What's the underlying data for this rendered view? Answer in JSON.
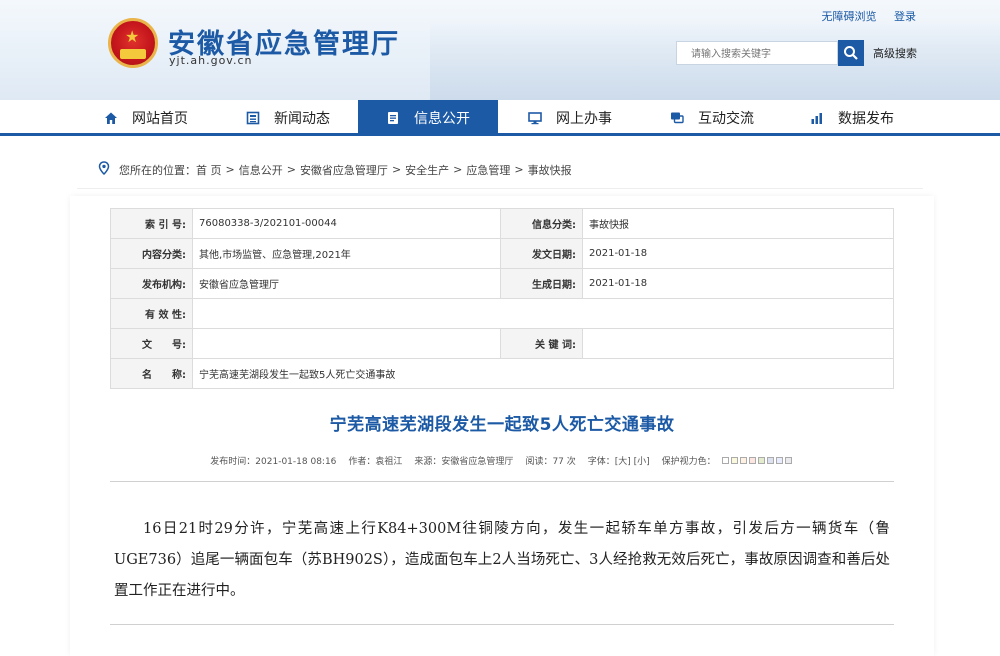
{
  "header": {
    "title": "安徽省应急管理厅",
    "domain": "yjt.ah.gov.cn",
    "links": {
      "accessibility": "无障碍浏览",
      "login": "登录"
    },
    "search": {
      "placeholder": "请输入搜索关键字",
      "advanced": "高级搜索"
    }
  },
  "nav": {
    "items": [
      {
        "label": "网站首页",
        "icon": "home-icon"
      },
      {
        "label": "新闻动态",
        "icon": "news-icon"
      },
      {
        "label": "信息公开",
        "icon": "document-icon",
        "active": true
      },
      {
        "label": "网上办事",
        "icon": "monitor-icon"
      },
      {
        "label": "互动交流",
        "icon": "chat-icon"
      },
      {
        "label": "数据发布",
        "icon": "chart-icon"
      }
    ]
  },
  "breadcrumb": {
    "prefix": "您所在的位置：",
    "items": [
      "首 页",
      "信息公开",
      "安徽省应急管理厅",
      "安全生产",
      "应急管理",
      "事故快报"
    ],
    "separator": ">"
  },
  "meta": {
    "index_label": "索 引 号:",
    "index_value": "76080338-3/202101-00044",
    "category_label": "信息分类:",
    "category_value": "事故快报",
    "content_label": "内容分类:",
    "content_value": "其他,市场监管、应急管理,2021年",
    "publish_date_label": "发文日期:",
    "publish_date_value": "2021-01-18",
    "org_label": "发布机构:",
    "org_value": "安徽省应急管理厅",
    "gen_date_label": "生成日期:",
    "gen_date_value": "2021-01-18",
    "validity_label": "有 效 性:",
    "validity_value": "",
    "doc_no_label": "文　　号:",
    "doc_no_value": "",
    "keywords_label": "关 键 词:",
    "keywords_value": "",
    "name_label": "名　　称:",
    "name_value": "宁芜高速芜湖段发生一起致5人死亡交通事故"
  },
  "article": {
    "title": "宁芜高速芜湖段发生一起致5人死亡交通事故",
    "published": "发布时间：2021-01-18 08:16",
    "author": "作者：袁祖江",
    "source": "来源：安徽省应急管理厅",
    "reads": "阅读：77 次",
    "font": "字体：[大] [小]",
    "eye_protect": "保护视力色：",
    "body": "16日21时29分许，宁芜高速上行K84+300M往铜陵方向，发生一起轿车单方事故，引发后方一辆货车（鲁UGE736）追尾一辆面包车（苏BH902S），造成面包车上2人当场死亡、3人经抢救无效后死亡，事故原因调查和善后处置工作正在进行中。"
  },
  "colors": {
    "brand": "#1d5aa6",
    "eye_swatches": [
      "#ffffff",
      "#faf9de",
      "#fff2e2",
      "#fde6e0",
      "#e3edcd",
      "#dce2f1",
      "#e9ebfe",
      "#eaeaef"
    ]
  }
}
